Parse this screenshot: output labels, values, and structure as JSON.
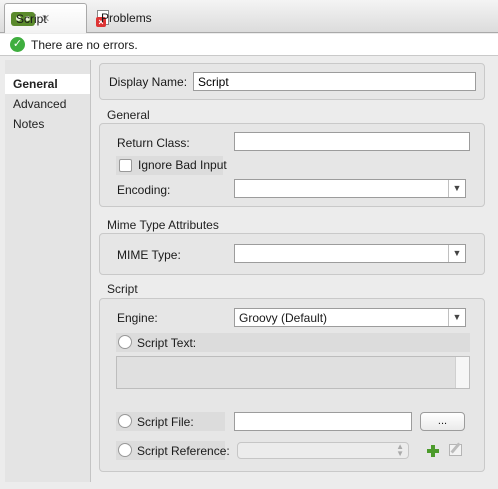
{
  "tabs": [
    {
      "label": "Script",
      "icon": "script-icon",
      "active": true
    },
    {
      "label": "Problems",
      "icon": "problems-icon",
      "active": false
    }
  ],
  "status": {
    "text": "There are no errors.",
    "icon": "check-circle-icon"
  },
  "nav": {
    "items": [
      "General",
      "Advanced",
      "Notes"
    ],
    "selected": "General"
  },
  "display_name": {
    "label": "Display Name:",
    "value": "Script"
  },
  "general": {
    "title": "General",
    "return_class_label": "Return Class:",
    "return_class_value": "",
    "ignore_bad_input_label": "Ignore Bad Input",
    "encoding_label": "Encoding:",
    "encoding_value": ""
  },
  "mime": {
    "title": "Mime Type Attributes",
    "mime_type_label": "MIME Type:",
    "mime_type_value": ""
  },
  "script": {
    "title": "Script",
    "engine_label": "Engine:",
    "engine_value": "Groovy (Default)",
    "script_text_label": "Script Text:",
    "script_file_label": "Script File:",
    "script_file_value": "",
    "browse_label": "...",
    "script_reference_label": "Script Reference:"
  },
  "colors": {
    "accent_green": "#5a8a2c",
    "ok_green": "#3fae3f",
    "error_red": "#dd3333"
  }
}
